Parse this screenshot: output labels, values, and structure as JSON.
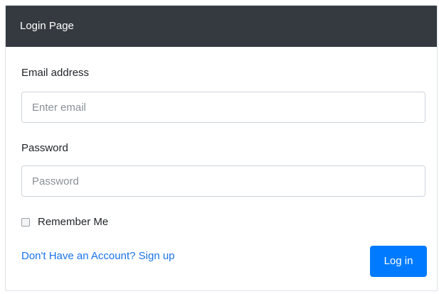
{
  "header": {
    "title": "Login Page"
  },
  "form": {
    "email_label": "Email address",
    "email_placeholder": "Enter email",
    "email_value": "",
    "password_label": "Password",
    "password_placeholder": "Password",
    "password_value": "",
    "remember_label": "Remember Me",
    "remember_checked": false,
    "signup_link": "Don't Have an Account? Sign up",
    "login_button": "Log in"
  },
  "colors": {
    "header_bg": "#343a40",
    "primary": "#007bff",
    "link": "#1a73e8"
  }
}
